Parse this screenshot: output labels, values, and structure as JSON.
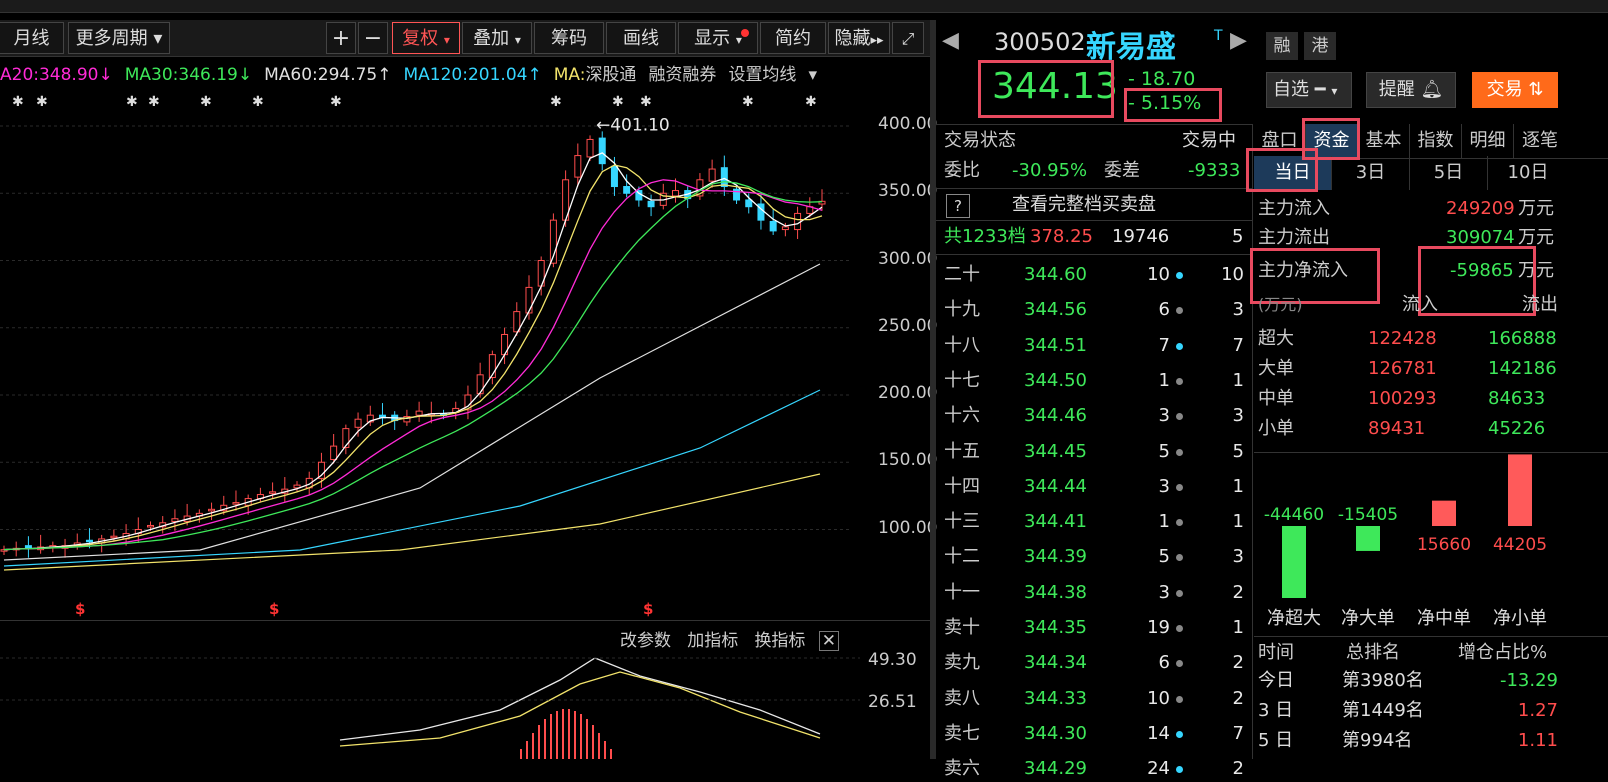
{
  "toolbar": {
    "items": [
      "月线",
      "更多周期",
      "+",
      "−",
      "复权",
      "叠加",
      "筹码",
      "画线",
      "显示",
      "简约",
      "隐藏"
    ]
  },
  "ma": {
    "ma20": "A20:348.90↓",
    "ma30": "MA30:346.19↓",
    "ma60": "MA60:294.75↑",
    "ma120": "MA120:201.04↑",
    "ma_last": "MA:",
    "links": [
      "深股通",
      "融资融券",
      "设置均线"
    ]
  },
  "chart_data": {
    "type": "candlestick",
    "yticks": [
      400,
      350,
      300,
      250,
      200,
      150,
      100
    ],
    "ytick_labels": [
      "400.00",
      "350.00",
      "300.00",
      "250.00",
      "200.00",
      "150.00",
      "100.00"
    ],
    "high_annotation": "401.10",
    "close_series": [
      85,
      86,
      86,
      87,
      88,
      88,
      90,
      91,
      93,
      95,
      97,
      100,
      103,
      105,
      108,
      110,
      112,
      115,
      118,
      120,
      123,
      126,
      128,
      130,
      133,
      138,
      150,
      162,
      175,
      182,
      185,
      183,
      181,
      184,
      188,
      186,
      185,
      190,
      200,
      215,
      230,
      245,
      262,
      280,
      300,
      330,
      360,
      378,
      390,
      372,
      355,
      350,
      345,
      340,
      350,
      352,
      346,
      360,
      368,
      355,
      345,
      340,
      330,
      322,
      325,
      335,
      340,
      344
    ]
  },
  "sub_panel": {
    "buttons": [
      "改参数",
      "加指标",
      "换指标"
    ],
    "yticks": [
      "49.30",
      "26.51"
    ]
  },
  "stock": {
    "code": "300502",
    "name": "新易盛",
    "badge": "T",
    "tags": [
      "融",
      "港"
    ],
    "price": "344.13",
    "change": "- 18.70",
    "pct": "- 5.15%",
    "watchlist": "自选",
    "alert": "提醒",
    "trade": "交易"
  },
  "orderbook": {
    "status_label": "交易状态",
    "status_value": "交易中",
    "weibi_label": "委比",
    "weibi_value": "-30.95%",
    "weicha_label": "委差",
    "weicha_value": "-9333",
    "help": "?",
    "full_book": "查看完整档买卖盘",
    "total_label": "共1233档",
    "total_price": "378.25",
    "total_vol": "19746",
    "total_cnt": "5",
    "rows": [
      {
        "label": "二十",
        "price": "344.60",
        "vol": "10",
        "dot": "cyan",
        "cnt": "10"
      },
      {
        "label": "十九",
        "price": "344.56",
        "vol": "6",
        "dot": "gray",
        "cnt": "3"
      },
      {
        "label": "十八",
        "price": "344.51",
        "vol": "7",
        "dot": "cyan",
        "cnt": "7"
      },
      {
        "label": "十七",
        "price": "344.50",
        "vol": "1",
        "dot": "gray",
        "cnt": "1"
      },
      {
        "label": "十六",
        "price": "344.46",
        "vol": "3",
        "dot": "gray",
        "cnt": "3"
      },
      {
        "label": "十五",
        "price": "344.45",
        "vol": "5",
        "dot": "gray",
        "cnt": "5"
      },
      {
        "label": "十四",
        "price": "344.44",
        "vol": "3",
        "dot": "gray",
        "cnt": "1"
      },
      {
        "label": "十三",
        "price": "344.41",
        "vol": "1",
        "dot": "gray",
        "cnt": "1"
      },
      {
        "label": "十二",
        "price": "344.39",
        "vol": "5",
        "dot": "gray",
        "cnt": "3"
      },
      {
        "label": "十一",
        "price": "344.38",
        "vol": "3",
        "dot": "gray",
        "cnt": "2"
      },
      {
        "label": "卖十",
        "price": "344.35",
        "vol": "19",
        "dot": "gray",
        "cnt": "1"
      },
      {
        "label": "卖九",
        "price": "344.34",
        "vol": "6",
        "dot": "gray",
        "cnt": "2"
      },
      {
        "label": "卖八",
        "price": "344.33",
        "vol": "10",
        "dot": "gray",
        "cnt": "2"
      },
      {
        "label": "卖七",
        "price": "344.30",
        "vol": "14",
        "dot": "cyan",
        "cnt": "7"
      },
      {
        "label": "卖六",
        "price": "344.29",
        "vol": "24",
        "dot": "cyan",
        "cnt": "2"
      }
    ]
  },
  "tabs": {
    "main": [
      "盘口",
      "资金",
      "基本",
      "指数",
      "明细",
      "逐笔"
    ],
    "period": [
      "当日",
      "3日",
      "5日",
      "10日"
    ]
  },
  "fund": {
    "inflow_label": "主力流入",
    "inflow_value": "249209",
    "outflow_label": "主力流出",
    "outflow_value": "309074",
    "net_label": "主力净流入",
    "net_value": "-59865",
    "unit": "万元",
    "table_head": [
      "(万元)",
      "流入",
      "流出"
    ],
    "table": [
      {
        "label": "超大",
        "in": "122428",
        "out": "166888"
      },
      {
        "label": "大单",
        "in": "126781",
        "out": "142186"
      },
      {
        "label": "中单",
        "in": "100293",
        "out": "84633"
      },
      {
        "label": "小单",
        "in": "89431",
        "out": "45226"
      }
    ],
    "net_bars": [
      {
        "label": "净超大",
        "value": "-44460",
        "num": -44460
      },
      {
        "label": "净大单",
        "value": "-15405",
        "num": -15405
      },
      {
        "label": "净中单",
        "value": "15660",
        "num": 15660
      },
      {
        "label": "净小单",
        "value": "44205",
        "num": 44205
      }
    ],
    "rank_head": [
      "时间",
      "总排名",
      "增仓占比%"
    ],
    "rank": [
      {
        "t": "今日",
        "rank": "第3980名",
        "pct": "-13.29"
      },
      {
        "t": "3 日",
        "rank": "第1449名",
        "pct": "1.27"
      },
      {
        "t": "5 日",
        "rank": "第994名",
        "pct": "1.11"
      }
    ]
  }
}
